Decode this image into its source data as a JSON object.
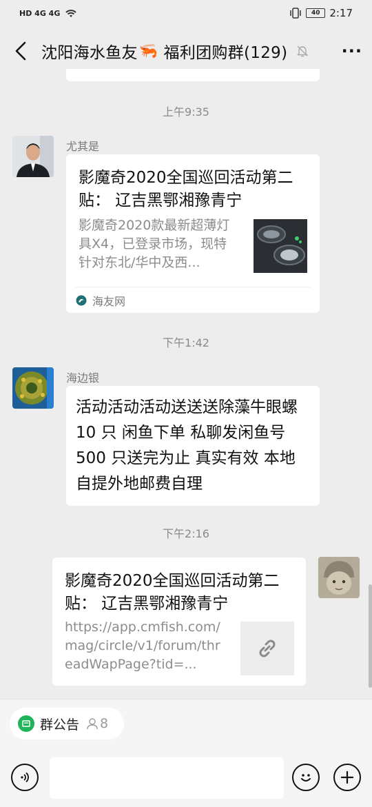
{
  "status": {
    "left_icons": "HD 4G 4G",
    "battery": "40",
    "time": "2:17"
  },
  "header": {
    "title_prefix": "沈阳海水鱼友",
    "title_emoji": "🦐",
    "title_suffix": "福利团购群(129)",
    "more": "···"
  },
  "messages": [
    {
      "time": "上午9:35",
      "sender": "尤其是",
      "type": "link-card",
      "title": "影魔奇2020全国巡回活动第二贴： 辽吉黑鄂湘豫青宁",
      "desc": "影魔奇2020款最新超薄灯具X4，已登录市场，现特针对东北/华中及西...",
      "source": "海友网"
    },
    {
      "time": "下午1:42",
      "sender": "海边银",
      "type": "text",
      "text": "活动活动活动送送送除藻牛眼螺 10 只 闲鱼下单 私聊发闲鱼号 500 只送完为止 真实有效 本地自提外地邮费自理"
    },
    {
      "time": "下午2:16",
      "type": "self-link-card",
      "title": "影魔奇2020全国巡回活动第二贴： 辽吉黑鄂湘豫青宁",
      "desc": "https://app.cmfish.com/mag/circle/v1/forum/threadWapPage?tid=..."
    }
  ],
  "bottom": {
    "notice_label": "群公告",
    "notice_count": "8",
    "input_placeholder": ""
  }
}
